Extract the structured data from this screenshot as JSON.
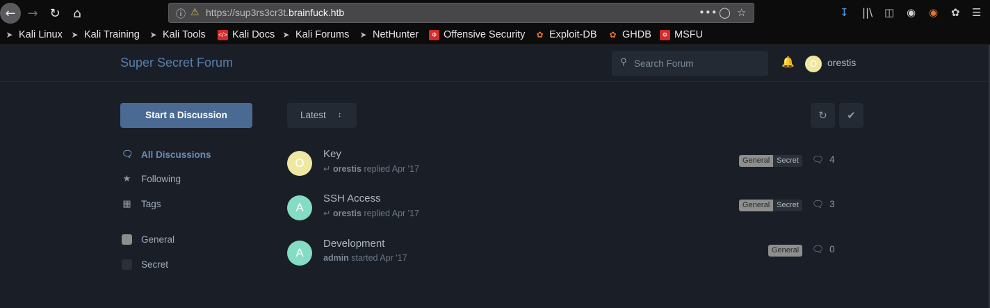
{
  "browser": {
    "url_prefix": "https://sup3rs3cr3t.",
    "url_domain": "brainfuck.htb"
  },
  "bookmarks": [
    {
      "label": "Kali Linux",
      "icon": "kali-dragon-icon"
    },
    {
      "label": "Kali Training",
      "icon": "kali-dragon-icon"
    },
    {
      "label": "Kali Tools",
      "icon": "kali-dragon-icon"
    },
    {
      "label": "Kali Docs",
      "icon": "kali-docs-icon"
    },
    {
      "label": "Kali Forums",
      "icon": "kali-dragon-icon"
    },
    {
      "label": "NetHunter",
      "icon": "kali-dragon-icon"
    },
    {
      "label": "Offensive Security",
      "icon": "offsec-icon"
    },
    {
      "label": "Exploit-DB",
      "icon": "exploit-db-icon"
    },
    {
      "label": "GHDB",
      "icon": "ghdb-icon"
    },
    {
      "label": "MSFU",
      "icon": "offsec-icon"
    }
  ],
  "forum": {
    "title": "Super Secret Forum",
    "search_placeholder": "Search Forum",
    "user": {
      "initial": "O",
      "name": "orestis"
    }
  },
  "sidebar": {
    "start_button": "Start a Discussion",
    "nav": [
      {
        "label": "All Discussions",
        "icon": "comments-icon"
      },
      {
        "label": "Following",
        "icon": "star-icon"
      },
      {
        "label": "Tags",
        "icon": "tags-grid-icon"
      }
    ],
    "tags": [
      {
        "label": "General",
        "color": "#8e8e8e"
      },
      {
        "label": "Secret",
        "color": "#2b3038"
      }
    ]
  },
  "toolbar": {
    "sort_label": "Latest"
  },
  "discussions": [
    {
      "initial": "O",
      "avatar_color": "#efe8a1",
      "title": "Key",
      "user": "orestis",
      "action": "replied Apr '17",
      "tags": [
        "General",
        "Secret"
      ],
      "replies": "4"
    },
    {
      "initial": "A",
      "avatar_color": "#83dcc3",
      "title": "SSH Access",
      "user": "orestis",
      "action": "replied Apr '17",
      "tags": [
        "General",
        "Secret"
      ],
      "replies": "3"
    },
    {
      "initial": "A",
      "avatar_color": "#83dcc3",
      "title": "Development",
      "user": "admin",
      "action": "started Apr '17",
      "tags": [
        "General"
      ],
      "replies": "0"
    }
  ]
}
